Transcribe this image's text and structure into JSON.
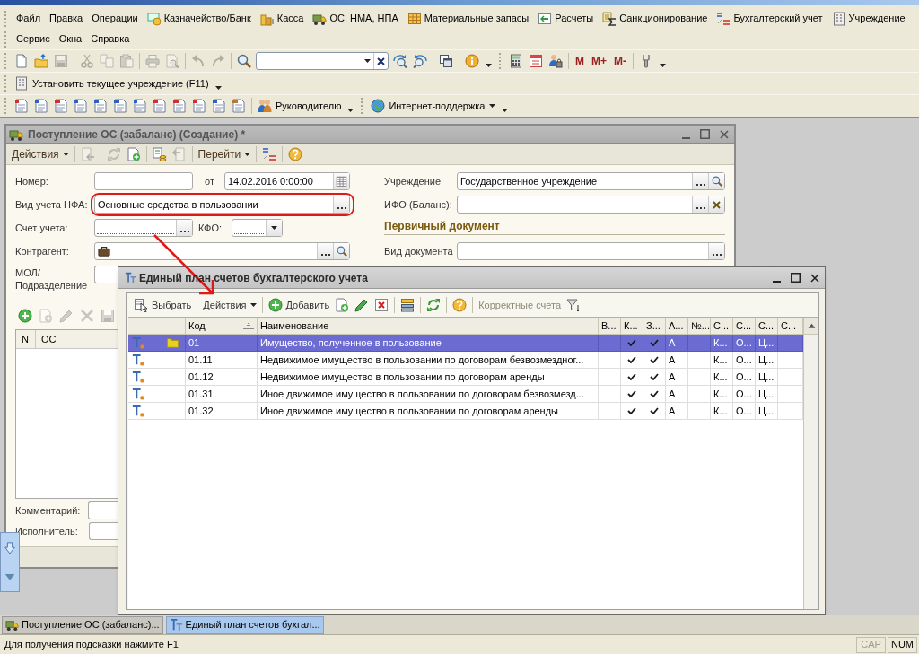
{
  "menu_bar": [
    [
      {
        "label": "Файл"
      },
      {
        "label": "Правка"
      },
      {
        "label": "Операции"
      },
      {
        "label": "Казначейство/Банк"
      },
      {
        "label": "Касса"
      },
      {
        "label": "ОС, НМА, НПА"
      },
      {
        "label": "Материальные запасы"
      },
      {
        "label": "Расчеты"
      },
      {
        "label": "Санкционирование"
      },
      {
        "label": "Бухгалтерский учет"
      },
      {
        "label": "Учреждение"
      }
    ],
    [
      {
        "label": "Сервис"
      },
      {
        "label": "Окна"
      },
      {
        "label": "Справка"
      }
    ]
  ],
  "toolbar_rows": [
    [
      {
        "groups": [
          [
            {
              "kind": "icon",
              "disabled": false
            },
            {
              "kind": "icon",
              "disabled": false
            },
            {
              "kind": "icon",
              "disabled": true
            }
          ],
          [
            {
              "kind": "icon",
              "disabled": true
            },
            {
              "kind": "icon",
              "disabled": true
            },
            {
              "kind": "icon",
              "disabled": true
            }
          ],
          [
            {
              "kind": "icon",
              "disabled": true
            },
            {
              "kind": "icon",
              "disabled": true
            }
          ],
          [
            {
              "kind": "icon",
              "disabled": true
            },
            {
              "kind": "icon",
              "disabled": true
            }
          ],
          [
            {
              "kind": "icon",
              "disabled": false
            },
            {
              "kind": "search"
            },
            {
              "kind": "icon",
              "disabled": false
            },
            {
              "kind": "icon",
              "disabled": false
            }
          ],
          [
            {
              "kind": "icon",
              "disabled": false
            }
          ],
          [
            {
              "kind": "icon",
              "disabled": false
            }
          ]
        ]
      },
      {
        "groups": [
          [
            {
              "kind": "icon",
              "disabled": false
            },
            {
              "kind": "icon",
              "disabled": false
            },
            {
              "kind": "icon",
              "disabled": false
            }
          ],
          [
            {
              "kind": "text",
              "label": "M"
            },
            {
              "kind": "text",
              "label": "M+"
            },
            {
              "kind": "text",
              "label": "M-"
            }
          ],
          [
            {
              "kind": "icon",
              "disabled": false
            }
          ]
        ]
      }
    ],
    [
      {
        "groups": [
          [
            {
              "kind": "button",
              "label": "Установить текущее учреждение (F11)",
              "disabled": false
            }
          ]
        ]
      }
    ],
    [
      {
        "groups": [
          [
            {
              "kind": "icon",
              "disabled": false
            },
            {
              "kind": "icon",
              "disabled": false
            },
            {
              "kind": "icon",
              "disabled": false
            },
            {
              "kind": "icon",
              "disabled": false
            },
            {
              "kind": "icon",
              "disabled": false
            },
            {
              "kind": "icon",
              "disabled": false
            },
            {
              "kind": "icon",
              "disabled": false
            },
            {
              "kind": "icon",
              "disabled": false
            },
            {
              "kind": "icon",
              "disabled": false
            },
            {
              "kind": "icon",
              "disabled": false
            },
            {
              "kind": "icon",
              "disabled": false
            },
            {
              "kind": "icon",
              "disabled": false
            }
          ],
          [
            {
              "kind": "button",
              "label": "Руководителю",
              "disabled": false
            }
          ]
        ]
      },
      {
        "groups": [
          [
            {
              "kind": "menu",
              "label": "Интернет-поддержка"
            }
          ]
        ]
      }
    ]
  ],
  "document_window": {
    "title": "Поступление ОС (забаланс) (Создание) *",
    "toolbar": [
      [
        {
          "kind": "menu",
          "label": "Действия"
        }
      ],
      [
        {
          "kind": "icon",
          "disabled": true
        }
      ],
      [
        {
          "kind": "icon",
          "disabled": true
        },
        {
          "kind": "icon",
          "disabled": false
        }
      ],
      [
        {
          "kind": "icon",
          "disabled": false
        },
        {
          "kind": "icon",
          "disabled": true
        }
      ],
      [
        {
          "kind": "menu",
          "label": "Перейти"
        }
      ],
      [
        {
          "kind": "icon",
          "disabled": false
        }
      ],
      [
        {
          "kind": "icon",
          "disabled": false
        }
      ]
    ],
    "header": {
      "number": {
        "label": "Номер:"
      },
      "date": {
        "label": "от",
        "value": "14.02.2016 0:00:00"
      },
      "nfa_type": {
        "label": "Вид учета НФА:",
        "value": "Основные средства в пользовании",
        "highlighted": true
      },
      "account": {
        "label": "Счет учета:",
        "required": true
      },
      "kfo": {
        "label": "КФО:",
        "required": true
      },
      "counterparty": {
        "label": "Контрагент:"
      },
      "mol": {
        "label": "МОЛ/ Подразделение"
      },
      "institution": {
        "label": "Учреждение:",
        "value": "Государственное учреждение"
      },
      "ifo": {
        "label": "ИФО (Баланс):"
      },
      "section_title": "Первичный документ",
      "document_type": {
        "label": "Вид документа"
      }
    },
    "assets_table": {
      "toolbar": [
        {
          "disabled": false
        },
        {
          "disabled": true
        },
        {
          "disabled": true
        },
        {
          "disabled": true
        },
        {
          "disabled": true
        }
      ],
      "columns": [
        "N",
        "ОС"
      ]
    },
    "comment": {
      "label": "Комментарий:"
    },
    "executor": {
      "label": "Исполнитель:"
    }
  },
  "accounts_window": {
    "title": "Единый план счетов бухгалтерского учета",
    "toolbar": [
      [
        {
          "kind": "button",
          "label": "Выбрать",
          "disabled": false
        }
      ],
      [
        {
          "kind": "menu",
          "label": "Действия"
        }
      ],
      [
        {
          "kind": "button",
          "label": "Добавить",
          "disabled": false
        },
        {
          "kind": "icon",
          "disabled": false
        },
        {
          "kind": "icon",
          "disabled": false
        },
        {
          "kind": "icon",
          "disabled": false
        }
      ],
      [
        {
          "kind": "icon",
          "disabled": false
        }
      ],
      [
        {
          "kind": "icon",
          "disabled": false
        }
      ],
      [
        {
          "kind": "icon",
          "disabled": false
        }
      ],
      [
        {
          "kind": "button",
          "label": "Корректные счета",
          "disabled": true
        },
        {
          "kind": "icon",
          "disabled": false
        }
      ]
    ],
    "columns": [
      {
        "label": "Код",
        "kind": "text",
        "sorted": true
      },
      {
        "label": "Наименование",
        "kind": "text",
        "sorted": false
      },
      {
        "label": "В...",
        "kind": "text",
        "sorted": false
      },
      {
        "label": "К...",
        "kind": "check",
        "sorted": false
      },
      {
        "label": "З...",
        "kind": "check",
        "sorted": false
      },
      {
        "label": "А...",
        "kind": "text",
        "sorted": false
      },
      {
        "label": "№...",
        "kind": "text",
        "sorted": false
      },
      {
        "label": "С...",
        "kind": "text",
        "sorted": false
      },
      {
        "label": "С...",
        "kind": "text",
        "sorted": false
      },
      {
        "label": "С...",
        "kind": "text",
        "sorted": false
      },
      {
        "label": "С...",
        "kind": "text",
        "sorted": false
      }
    ],
    "rows": [
      {
        "selected": true,
        "folder": true,
        "cells": [
          "01",
          "Имущество, полученное в пользование",
          null,
          true,
          true,
          "А",
          null,
          "К...",
          "О...",
          "Ц...",
          null
        ]
      },
      {
        "selected": false,
        "folder": false,
        "cells": [
          "01.11",
          "Недвижимое имущество в пользовании по договорам безвозмездног...",
          null,
          true,
          true,
          "А",
          null,
          "К...",
          "О...",
          "Ц...",
          null
        ]
      },
      {
        "selected": false,
        "folder": false,
        "cells": [
          "01.12",
          "Недвижимое имущество в пользовании по договорам аренды",
          null,
          true,
          true,
          "А",
          null,
          "К...",
          "О...",
          "Ц...",
          null
        ]
      },
      {
        "selected": false,
        "folder": false,
        "cells": [
          "01.31",
          "Иное движимое имущество в пользовании по договорам безвозмезд...",
          null,
          true,
          true,
          "А",
          null,
          "К...",
          "О...",
          "Ц...",
          null
        ]
      },
      {
        "selected": false,
        "folder": false,
        "cells": [
          "01.32",
          "Иное движимое имущество в пользовании по договорам аренды",
          null,
          true,
          true,
          "А",
          null,
          "К...",
          "О...",
          "Ц...",
          null
        ]
      }
    ]
  },
  "taskbar": [
    {
      "label": "Поступление ОС (забаланс)...",
      "selected": false
    },
    {
      "label": "Единый план счетов бухгал...",
      "selected": true
    }
  ],
  "status_bar": {
    "hint": "Для получения подсказки нажмите F1",
    "indicators": [
      {
        "label": "CAP",
        "on": false
      },
      {
        "label": "NUM",
        "on": true
      }
    ]
  },
  "callout_arrow": true
}
